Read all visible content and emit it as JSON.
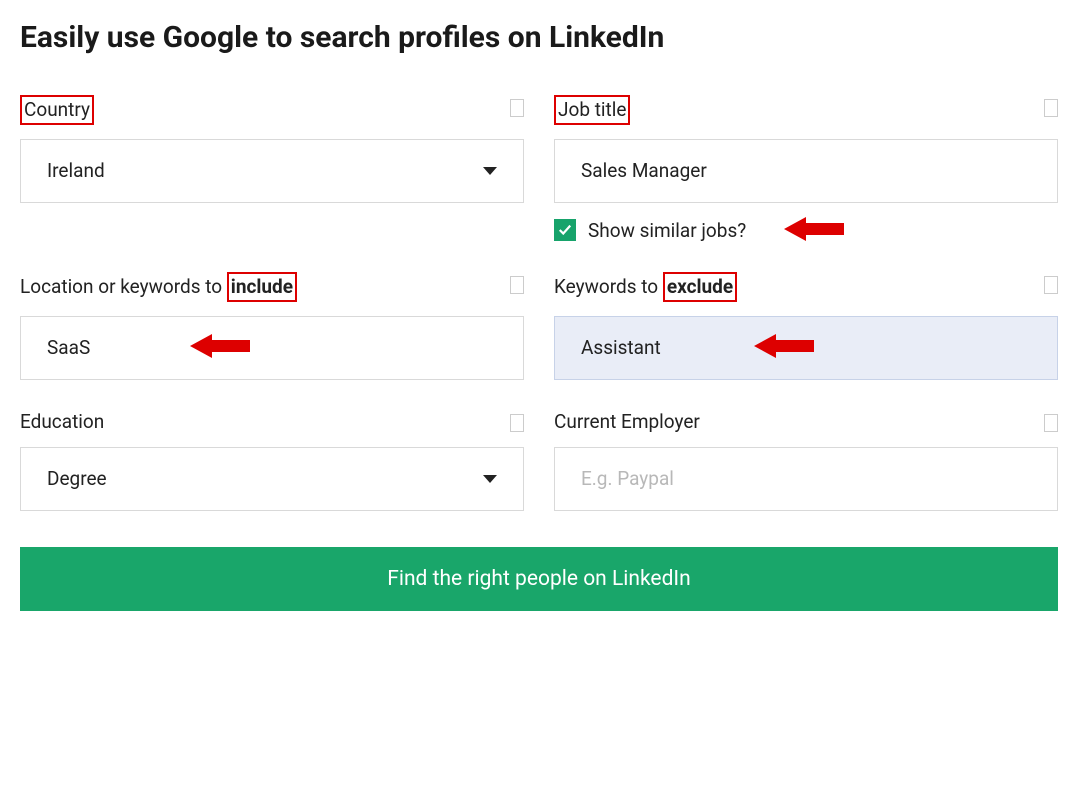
{
  "title": "Easily use Google to search profiles on LinkedIn",
  "fields": {
    "country": {
      "label": "Country",
      "value": "Ireland"
    },
    "job_title": {
      "label": "Job title",
      "value": "Sales Manager",
      "similar_label": "Show similar jobs?",
      "similar_checked": true
    },
    "include": {
      "label_pre": "Location or keywords to ",
      "label_keyword": "include",
      "value": "SaaS"
    },
    "exclude": {
      "label_pre": "Keywords to ",
      "label_keyword": "exclude",
      "value": "Assistant"
    },
    "education": {
      "label": "Education",
      "value": "Degree"
    },
    "employer": {
      "label": "Current Employer",
      "placeholder": "E.g. Paypal",
      "value": ""
    }
  },
  "submit_label": "Find the right people on LinkedIn"
}
